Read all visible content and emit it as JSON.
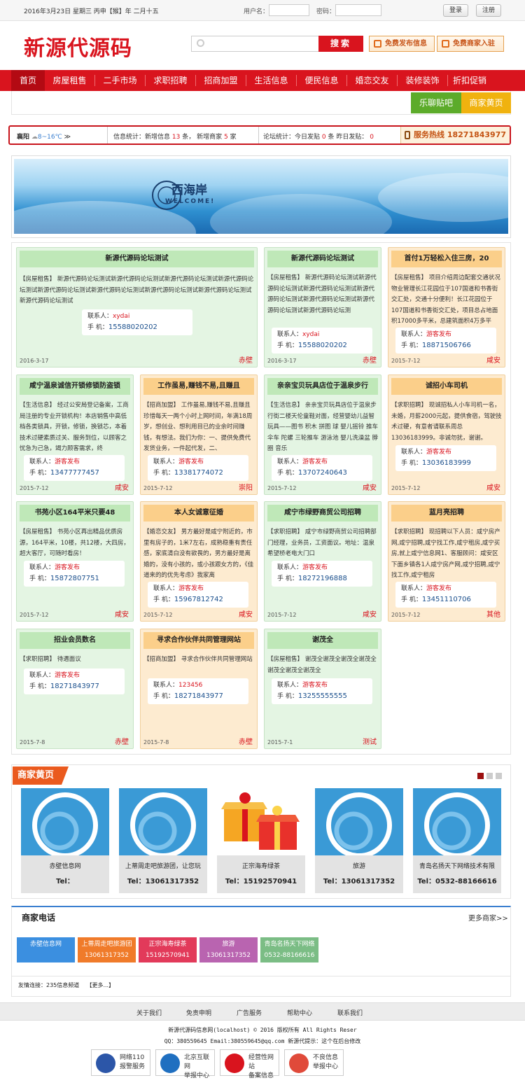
{
  "topbar": {
    "date": "2016年3月23日 星期三  丙申【猴】年 二月十五",
    "username_label": "用户名：",
    "password_label": "密码：",
    "login": "登录",
    "register": "注册"
  },
  "header": {
    "logo": "新源代源码",
    "search_button": "搜索",
    "free_post": "免费发布信息",
    "merchant_join": "免费商家入驻"
  },
  "nav": {
    "items": [
      "首页",
      "房屋租售",
      "二手市场",
      "求职招聘",
      "招商加盟",
      "生活信息",
      "便民信息",
      "婚恋交友",
      "装修装饰",
      "折扣促销"
    ],
    "forum": "乐聊贴吧",
    "yellow": "商家黄页"
  },
  "infobar": {
    "city": "襄阳",
    "weather": "8~16℃",
    "more": "≫",
    "stats_label": "信息统计：新增信息",
    "new_info": "13",
    "unit1": "条，",
    "new_merchant_label": "新增商家",
    "new_merchant": "5",
    "unit2": "家",
    "forum_label": "论坛统计：今日发贴",
    "today_posts": "0",
    "unit3": "条",
    "yesterday_label": "昨日发贴：",
    "yesterday_posts": "0",
    "hotline": "服务热线 18271843977"
  },
  "banner": {
    "text": "西海岸",
    "welcome": "WELCOME!"
  },
  "cards": [
    {
      "title": "新源代源码论坛测试",
      "body": "【房屋租售】 新源代源码论坛测试新源代源码论坛测试新源代源码论坛测试新源代源码论坛测试新源代源码论坛测试新源代源码论坛测试新源代源码论坛测试新源代源码论坛测试新源代源码论坛测试",
      "contact_label": "联系人：",
      "contact": "xydai",
      "phone_label": "手  机：",
      "phone": "15588020202",
      "date": "2016-3-17",
      "loc": "赤壁"
    },
    {
      "title": "新源代源码论坛测试",
      "body": "【房屋租售】 新源代源码论坛测试新源代源码论坛测试新源代源码论坛测试新源代源码论坛测试新源代源码论坛测试新源代源码论坛测试新源代源码论坛测",
      "contact_label": "联系人：",
      "contact": "xydai",
      "phone_label": "手  机：",
      "phone": "15588020202",
      "date": "2016-3-17",
      "loc": "赤壁"
    },
    {
      "title": "首付1万轻松入住三房，20",
      "body": "【房屋租售】 项目介绍周边配套交通状况物业管理长江花园位于107国道和书香街交汇处，交通十分便利！长江花园位于107国道和书香街交汇处，项目总占地面积17000多平米，总建筑面积4万多平米，其中商业街接",
      "contact_label": "联系人：",
      "contact": "游客发布",
      "phone_label": "手  机：",
      "phone": "18871506766",
      "date": "2015-7-12",
      "loc": "咸安"
    },
    {
      "title": "咸宁温泉诚信开锁修锁防盗锁",
      "body": "【生活信息】 经过公安局登记备案，工商局注册的专业开锁机构！本店销售中高低档各类锁具，开锁，修锁，换锁芯，本着技术过硬素质过关、服务到位，以顾客之忧急为己急，竭力顾客需求，终",
      "contact_label": "联系人：",
      "contact": "游客发布",
      "phone_label": "手  机：",
      "phone": "13477777457",
      "date": "2015-7-12",
      "loc": "咸安"
    },
    {
      "title": "工作虽易,赚钱不易,且赚且",
      "body": "【招商加盟】 工作虽易,赚钱不易,且赚且珍惜每天一两个小时上网时间，年满18周岁，想创业、想利用目已的业余时间赚钱，有想法。我们为你：一、提供免费代发货业务，一件起代发，二、",
      "contact_label": "联系人：",
      "contact": "游客发布",
      "phone_label": "手  机：",
      "phone": "13381774072",
      "date": "2015-7-12",
      "loc": "崇阳"
    },
    {
      "title": "亲亲宝贝玩具店位于温泉步行",
      "body": "【生活信息】 亲亲宝贝玩具店位于温泉步行街二楼天伦童鞋对面，经营婴幼儿益智玩具——图书 积木 拼图 球 婴儿摇铃 推车 伞车 陀螺 三轮推车 游泳池 婴儿洗澡盆 脖圈 音乐",
      "contact_label": "联系人：",
      "contact": "游客发布",
      "phone_label": "手  机：",
      "phone": "13707240643",
      "date": "2015-7-12",
      "loc": "咸安"
    },
    {
      "title": "诚招小车司机",
      "body": "【求职招聘】 现诚招私人小车司机一名，未婚，月薪2000元起，提供食宿，驾驶技术过硬，有意者请联系周总13036183999。非诚勿扰，谢谢。",
      "contact_label": "联系人：",
      "contact": "游客发布",
      "phone_label": "手  机：",
      "phone": "13036183999",
      "date": "2015-7-12",
      "loc": "咸安"
    },
    {
      "title": "书苑小区164平米只要48",
      "body": "【房屋租售】 书苑小区再出精品优质房源，164平米，10楼，共12楼，大四房，超大客厅，可随时看房！",
      "contact_label": "联系人：",
      "contact": "游客发布",
      "phone_label": "手  机：",
      "phone": "15872807751",
      "date": "2015-7-12",
      "loc": "咸安"
    },
    {
      "title": "本人女诚意征婚",
      "body": "【婚恋交友】 男方最好是咸宁附近的，市里有房子的，1米7左右，成熟稳重有责任感，家底清白没有欲畏的，男方最好是离婚的，没有小孩的，或小孩跟女方的，《佳道来的的优先考虑》我家离",
      "contact_label": "联系人：",
      "contact": "游客发布",
      "phone_label": "手  机：",
      "phone": "15967812742",
      "date": "2015-7-12",
      "loc": "咸安"
    },
    {
      "title": "咸宁市绿野商贸公司招聘",
      "body": "【求职招聘】 咸宁市绿野商贸公司招聘部门经理，业务员，工资面议。地址：温泉希望桥老电大门口",
      "contact_label": "联系人：",
      "contact": "游客发布",
      "phone_label": "手  机：",
      "phone": "18272196888",
      "date": "2015-7-12",
      "loc": "咸安"
    },
    {
      "title": "蓝月亮招聘",
      "body": "【求职招聘】 现招聘以下人员：咸宁房产网,咸宁招聘,咸宁找工作,咸宁租房,咸宁买房,就上咸宁信息网1、客服顾问：咸安区下面乡镇各1人咸宁房产网,咸宁招聘,咸宁找工作,咸宁租房",
      "contact_label": "联系人：",
      "contact": "游客发布",
      "phone_label": "手  机：",
      "phone": "13451110706",
      "date": "2015-7-12",
      "loc": "其他"
    },
    {
      "title": "招业会员数名",
      "body": "【求职招聘】 待遇面议",
      "contact_label": "联系人：",
      "contact": "游客发布",
      "phone_label": "手  机：",
      "phone": "18271843977",
      "date": "2015-7-8",
      "loc": "赤壁"
    },
    {
      "title": "寻求合作伙伴共同管理网站",
      "body": "【招商加盟】 寻求合作伙伴共同管理网站",
      "contact_label": "联系人：",
      "contact": "123456",
      "phone_label": "手  机：",
      "phone": "18271843977",
      "date": "2015-7-8",
      "loc": "赤壁"
    },
    {
      "title": "谢茂全",
      "body": "【房屋租售】 谢茂全谢茂全谢茂全谢茂全谢茂全谢茂全谢茂全",
      "contact_label": "联系人：",
      "contact": "游客发布",
      "phone_label": "手  机：",
      "phone": "13255555555",
      "date": "2015-7-1",
      "loc": "测试"
    }
  ],
  "merchants": {
    "title": "商家黄页",
    "items": [
      {
        "name": "赤壁信息网",
        "tel": "Tel："
      },
      {
        "name": "上蒂周走吧旅游团，让您玩",
        "tel": "Tel：13061317352"
      },
      {
        "name": "正宗海寿绿茶",
        "tel": "Tel：15192570941"
      },
      {
        "name": "旅游",
        "tel": "Tel：13061317352"
      },
      {
        "name": "青岛名扬天下网络技术有限",
        "tel": "Tel：0532-88166616"
      }
    ]
  },
  "phones": {
    "title": "商家电话",
    "more": "更多商家>>",
    "items": [
      {
        "name": "赤壁信息网",
        "tel": "",
        "color": "#3b8fe0"
      },
      {
        "name": "上蒂周走吧旅游团",
        "tel": "13061317352",
        "color": "#f07b2a"
      },
      {
        "name": "正宗海寿绿茶",
        "tel": "15192570941",
        "color": "#e23a5a"
      },
      {
        "name": "旅游",
        "tel": "13061317352",
        "color": "#b964b0"
      },
      {
        "name": "青岛名扬天下网络",
        "tel": "0532-88166616",
        "color": "#7bbd85"
      }
    ]
  },
  "links": {
    "label": "友情连接：",
    "item": "235信息频道",
    "more": "【更多...】"
  },
  "footer": {
    "nav": [
      "关于我们",
      "免责申明",
      "广告服务",
      "帮助中心",
      "联系我们"
    ],
    "copyright": "新源代源码信息网(localhost) © 2016 版权所有 All Rights Reser",
    "contact": "QQ：380559645 Email:380559645@qq.com 新源代提示：这个在后台修改",
    "badges": [
      {
        "line1": "网络110",
        "line2": "报警服务"
      },
      {
        "line1": "北京互联网",
        "line2": "举报中心"
      },
      {
        "line1": "经营性网站",
        "line2": "备案信息"
      },
      {
        "line1": "不良信息",
        "line2": "举报中心"
      }
    ]
  }
}
